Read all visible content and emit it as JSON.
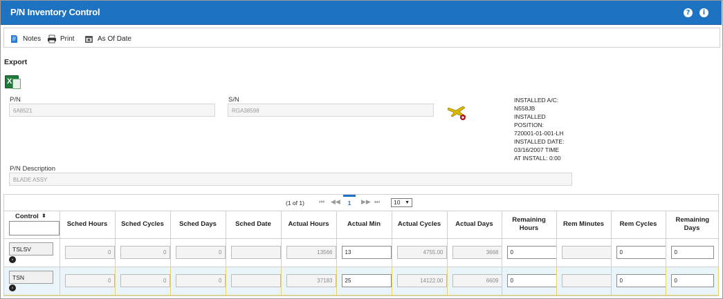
{
  "title": "P/N Inventory Control",
  "header_icons": {
    "help": "?",
    "info": "i"
  },
  "toolbar": {
    "notes": "Notes",
    "print": "Print",
    "as_of_date": "As Of Date"
  },
  "export_label": "Export",
  "export_icon_text": "X",
  "fields": {
    "pn_label": "P/N",
    "pn_value": "6A8521",
    "sn_label": "S/N",
    "sn_value": "RGA38598",
    "desc_label": "P/N Description",
    "desc_value": "BLADE ASSY"
  },
  "installed_info": [
    "INSTALLED A/C:",
    "N558JB",
    "INSTALLED",
    "POSITION:",
    "720001-01-001-LH",
    "INSTALLED DATE:",
    "03/16/2007 TIME",
    "AT INSTALL: 0:00"
  ],
  "pager": {
    "info": "(1 of 1)",
    "page": "1",
    "page_size": "10"
  },
  "columns": [
    "Control",
    "Sched Hours",
    "Sched Cycles",
    "Sched Days",
    "Sched Date",
    "Actual Hours",
    "Actual Min",
    "Actual Cycles",
    "Actual Days",
    "Remaining Hours",
    "Rem Minutes",
    "Rem Cycles",
    "Remaining Days"
  ],
  "rows": [
    {
      "control": "TSLSV",
      "sched_hours": "0",
      "sched_cycles": "0",
      "sched_days": "0",
      "sched_date": "",
      "actual_hours": "13566",
      "actual_min": "13",
      "actual_cycles": "4755.00",
      "actual_days": "3668",
      "rem_hours": "0",
      "rem_minutes": "",
      "rem_cycles": "0",
      "rem_days": "0"
    },
    {
      "control": "TSN",
      "sched_hours": "0",
      "sched_cycles": "0",
      "sched_days": "0",
      "sched_date": "",
      "actual_hours": "37183",
      "actual_min": "25",
      "actual_cycles": "14122.00",
      "actual_days": "6609",
      "rem_hours": "0",
      "rem_minutes": "",
      "rem_cycles": "0",
      "rem_days": "0"
    }
  ]
}
